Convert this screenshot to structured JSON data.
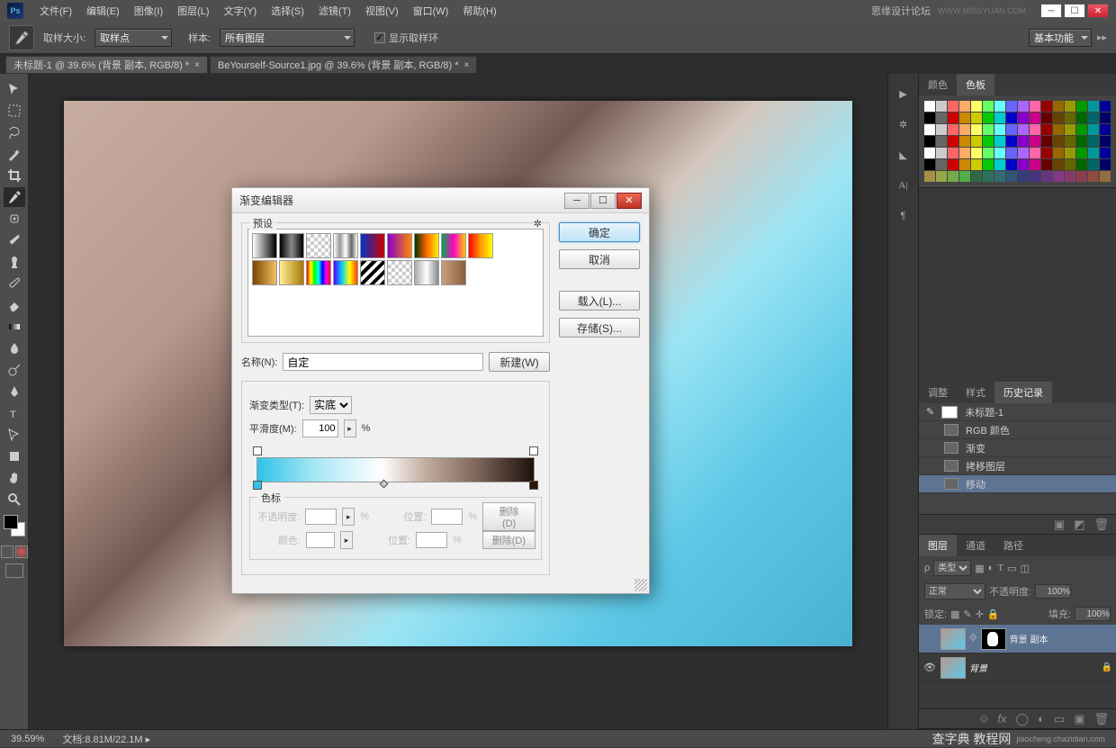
{
  "app": {
    "icon_text": "Ps",
    "brand_text": "思缘设计论坛",
    "brand_site": "WWW.MISSYUAN.COM"
  },
  "menu": [
    "文件(F)",
    "编辑(E)",
    "图像(I)",
    "图层(L)",
    "文字(Y)",
    "选择(S)",
    "滤镜(T)",
    "视图(V)",
    "窗口(W)",
    "帮助(H)"
  ],
  "options": {
    "sample_size_label": "取样大小:",
    "sample_size_value": "取样点",
    "sample_label": "样本:",
    "sample_value": "所有图层",
    "show_ring_label": "显示取样环",
    "workspace": "基本功能"
  },
  "tabs": [
    "未标题-1 @ 39.6% (背景 副本, RGB/8) *",
    "BeYourself-Source1.jpg @ 39.6% (背景 副本, RGB/8) *"
  ],
  "status": {
    "zoom": "39.59%",
    "doc_label": "文档:",
    "doc_info": "8.81M/22.1M"
  },
  "attribution": {
    "site1": "查字典 教程网",
    "site2": "jiaocheng.chazidian.com"
  },
  "swatches_panel": {
    "tab1": "颜色",
    "tab2": "色板"
  },
  "adjust_panel": {
    "tab1": "调整",
    "tab2": "样式",
    "tab3": "历史记录",
    "doc": "未标题-1"
  },
  "history": [
    "RGB 颜色",
    "渐变",
    "拷移图层",
    "移动"
  ],
  "layers_panel": {
    "tab1": "图层",
    "tab2": "通道",
    "tab3": "路径",
    "kind_label": "类型",
    "blend_mode": "正常",
    "opacity_label": "不透明度:",
    "opacity_value": "100%",
    "lock_label": "锁定:",
    "fill_label": "填充:",
    "fill_value": "100%"
  },
  "layers": [
    {
      "name": "背景 副本",
      "visible": false,
      "has_mask": true
    },
    {
      "name": "背景",
      "visible": true,
      "italic": true,
      "locked": true
    }
  ],
  "dialog": {
    "title": "渐变编辑器",
    "presets_label": "预设",
    "ok": "确定",
    "cancel": "取消",
    "load": "载入(L)...",
    "save": "存储(S)...",
    "name_label": "名称(N):",
    "name_value": "自定",
    "new_btn": "新建(W)",
    "type_label": "渐变类型(T):",
    "type_value": "实底",
    "smooth_label": "平滑度(M):",
    "smooth_value": "100",
    "percent": "%",
    "stops_label": "色标",
    "opacity_label": "不透明度:",
    "pos_label": "位置:",
    "color_label": "颜色:",
    "delete_label": "删除(D)"
  },
  "chart_data": {
    "type": "gradient",
    "name": "自定",
    "gradient_type": "实底",
    "smoothness": 100,
    "color_stops": [
      {
        "location_pct": 0,
        "color": "#30c2e8"
      },
      {
        "location_pct": 45,
        "color": "#ffffff"
      },
      {
        "location_pct": 100,
        "color": "#1e100a"
      }
    ],
    "opacity_stops": [
      {
        "location_pct": 0,
        "opacity_pct": 100
      },
      {
        "location_pct": 100,
        "opacity_pct": 100
      }
    ],
    "preview_colors": [
      "#30c2e8",
      "#a3e6f5",
      "#ffffff",
      "#c5b0a2",
      "#7b6358",
      "#1e100a"
    ]
  },
  "preset_gradients": [
    "linear-gradient(90deg,#fff,#000)",
    "linear-gradient(90deg,#000,#888,#000)",
    "repeating-conic-gradient(#ccc 0% 25%,#fff 0% 50%)",
    "linear-gradient(90deg,#fff,#999,#fff,#666,#fff)",
    "linear-gradient(90deg,#0033cc,#cc0000)",
    "linear-gradient(90deg,#8800cc,#ff8800)",
    "linear-gradient(90deg,#003300,#ff6600,#ffee00)",
    "linear-gradient(90deg,#00aa44,#ff00cc,#ffcc00)",
    "linear-gradient(90deg,#ff0000,#ff9900,#ffff00)",
    "linear-gradient(90deg,#7a4500,#f0c060)",
    "linear-gradient(90deg,#ffee99,#aa7700)",
    "linear-gradient(90deg,#f00,#ff0,#0f0,#0ff,#00f,#f0f,#f00)",
    "linear-gradient(90deg,#5500ff,#00ccff,#ffff00,#ff4400)",
    "repeating-linear-gradient(-45deg,#000 0 4px,#fff 4px 8px)",
    "repeating-conic-gradient(#ccc 0% 25%,#fff 0% 50%)",
    "linear-gradient(90deg,#aaa,#fff,#888)",
    "linear-gradient(90deg,#c8a080,#8a5e40)"
  ]
}
